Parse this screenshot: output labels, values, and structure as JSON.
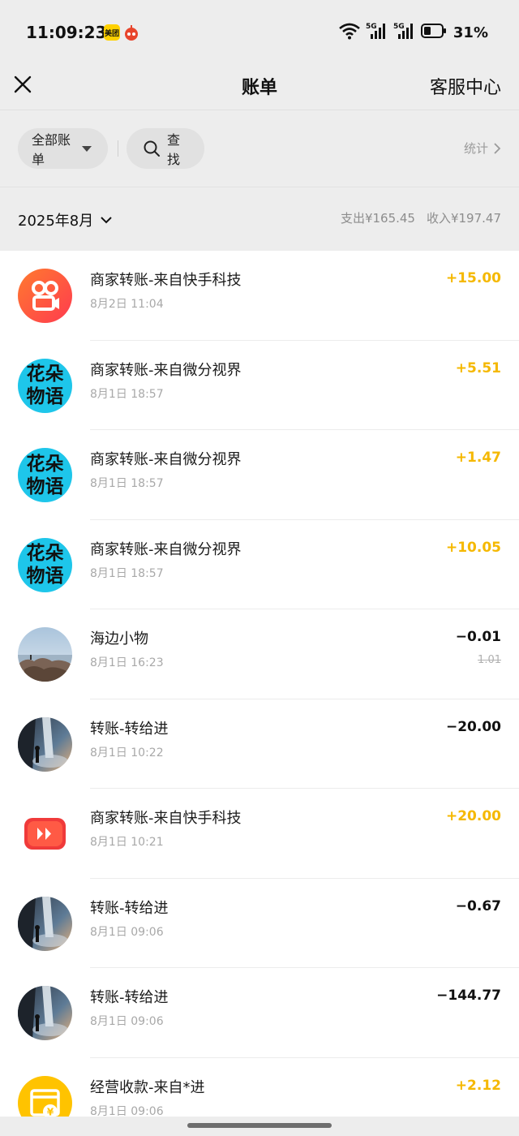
{
  "status_bar": {
    "time": "11:09:23",
    "battery_percent": "31%",
    "app_icons": [
      "meituan-icon",
      "notification-app-icon"
    ],
    "network": [
      "wifi-icon",
      "5g-signal-icon",
      "5g-signal-icon"
    ]
  },
  "header": {
    "title": "账单",
    "customer_service": "客服中心"
  },
  "filters": {
    "all_bills": "全部账单",
    "search": "查找",
    "stats": "统计"
  },
  "month": {
    "label": "2025年8月",
    "expense": "支出¥165.45",
    "income": "收入¥197.47"
  },
  "transactions": [
    {
      "title": "商家转账-来自快手科技",
      "time": "8月2日 11:04",
      "amount": "+15.00",
      "direction": "in",
      "avatar": "kuaishou-icon"
    },
    {
      "title": "商家转账-来自微分视界",
      "time": "8月1日 18:57",
      "amount": "+5.51",
      "direction": "in",
      "avatar": "huaduo-avatar",
      "avatar_text": [
        "花朵",
        "物语"
      ]
    },
    {
      "title": "商家转账-来自微分视界",
      "time": "8月1日 18:57",
      "amount": "+1.47",
      "direction": "in",
      "avatar": "huaduo-avatar",
      "avatar_text": [
        "花朵",
        "物语"
      ]
    },
    {
      "title": "商家转账-来自微分视界",
      "time": "8月1日 18:57",
      "amount": "+10.05",
      "direction": "in",
      "avatar": "huaduo-avatar",
      "avatar_text": [
        "花朵",
        "物语"
      ]
    },
    {
      "title": "海边小物",
      "time": "8月1日 16:23",
      "amount": "−0.01",
      "direction": "out",
      "original_amount": "1.01",
      "avatar": "seaside-photo-avatar"
    },
    {
      "title": "转账-转给进",
      "time": "8月1日 10:22",
      "amount": "−20.00",
      "direction": "out",
      "avatar": "waterfall-photo-avatar"
    },
    {
      "title": "商家转账-来自快手科技",
      "time": "8月1日 10:21",
      "amount": "+20.00",
      "direction": "in",
      "avatar": "kuaishou-lite-icon"
    },
    {
      "title": "转账-转给进",
      "time": "8月1日 09:06",
      "amount": "−0.67",
      "direction": "out",
      "avatar": "waterfall-photo-avatar"
    },
    {
      "title": "转账-转给进",
      "time": "8月1日 09:06",
      "amount": "−144.77",
      "direction": "out",
      "avatar": "waterfall-photo-avatar"
    },
    {
      "title": "经营收款-来自*进",
      "time": "8月1日 09:06",
      "amount": "+2.12",
      "direction": "in",
      "avatar": "business-receipt-icon"
    }
  ],
  "colors": {
    "income": "#f5b800",
    "expense": "#111111",
    "background": "#ededed"
  }
}
